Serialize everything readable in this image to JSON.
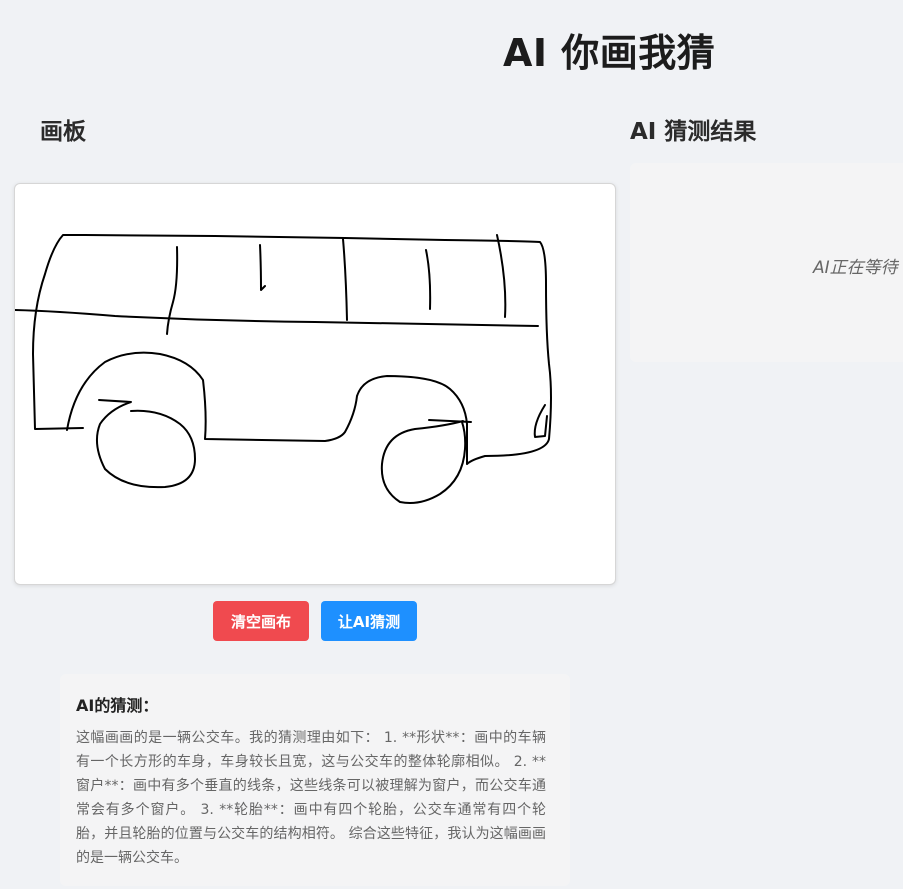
{
  "app": {
    "title": "AI 你画我猜"
  },
  "board": {
    "title": "画板",
    "buttons": {
      "clear": "清空画布",
      "guess": "让AI猜测"
    }
  },
  "result": {
    "title": "AI 猜测结果",
    "placeholder": "AI正在等待"
  },
  "guess": {
    "heading": "AI的猜测：",
    "text": "这幅画画的是一辆公交车。我的猜测理由如下： 1. **形状**：画中的车辆有一个长方形的车身，车身较长且宽，这与公交车的整体轮廓相似。 2. **窗户**：画中有多个垂直的线条，这些线条可以被理解为窗户，而公交车通常会有多个窗户。 3. **轮胎**：画中有四个轮胎，公交车通常有四个轮胎，并且轮胎的位置与公交车的结构相符。 综合这些特征，我认为这幅画画的是一辆公交车。"
  },
  "colors": {
    "background": "#f0f2f5",
    "clear_button": "#f04a4f",
    "guess_button": "#1e90ff",
    "panel": "#f4f4f5",
    "stroke": "#000000"
  },
  "icons": {
    "drawing": "bus-sketch"
  }
}
